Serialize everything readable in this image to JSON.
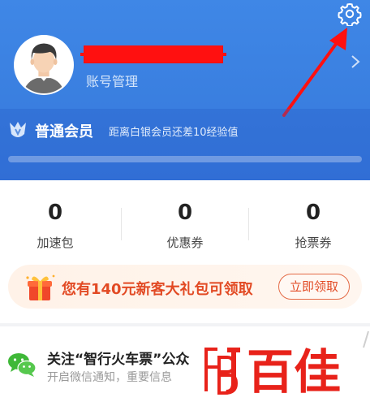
{
  "header": {
    "account_label": "账号管理"
  },
  "membership": {
    "level": "普通会员",
    "hint": "距离白银会员还差10经验值",
    "progress": 0.0
  },
  "stats": [
    {
      "value": "0",
      "label": "加速包"
    },
    {
      "value": "0",
      "label": "优惠券"
    },
    {
      "value": "0",
      "label": "抢票券"
    }
  ],
  "promo": {
    "text": "您有140元新客大礼包可领取",
    "button": "立即领取"
  },
  "wechat": {
    "title": "关注“智行火车票”公众",
    "subtitle": "开启微信通知，重要信息"
  },
  "watermark": {
    "text": "百佳"
  },
  "colors": {
    "header_blue": "#3a7fe0",
    "promo_red": "#e24a24",
    "wechat_green": "#3fb838",
    "annotation_red": "#ff1010"
  },
  "icons": {
    "settings": "gear-icon",
    "chevron": "chevron-right-icon",
    "level": "crown-icon",
    "gift": "gift-icon",
    "wechat": "wechat-icon"
  }
}
